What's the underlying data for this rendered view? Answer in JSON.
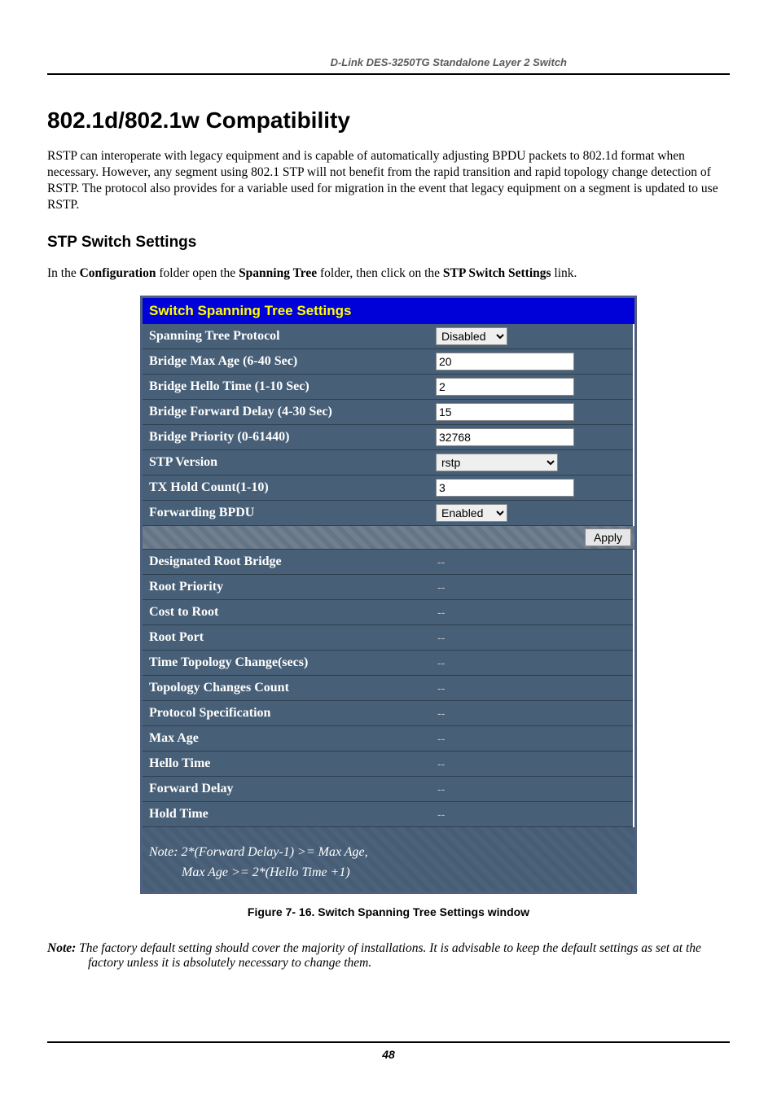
{
  "header": {
    "title": "D-Link DES-3250TG Standalone Layer 2 Switch"
  },
  "section": {
    "heading": "802.1d/802.1w Compatibility",
    "body": "RSTP can interoperate with legacy equipment and is capable of automatically adjusting BPDU packets to 802.1d format when necessary. However, any segment using 802.1 STP will not benefit from the rapid transition and rapid topology change detection of RSTP. The protocol also provides for a variable used for migration in the event that legacy equipment on a segment is updated to use RSTP."
  },
  "subsection": {
    "heading": "STP Switch Settings",
    "instruction_parts": {
      "p1": "In the ",
      "b1": "Configuration",
      "p2": " folder open the ",
      "b2": "Spanning Tree",
      "p3": " folder, then click on the ",
      "b3": "STP Switch Settings",
      "p4": " link."
    }
  },
  "panel": {
    "title": "Switch Spanning Tree Settings",
    "config_rows": [
      {
        "label": "Spanning Tree Protocol",
        "type": "select",
        "value": "Disabled",
        "width": "sm"
      },
      {
        "label": "Bridge Max Age (6-40 Sec)",
        "type": "text",
        "value": "20"
      },
      {
        "label": "Bridge Hello Time (1-10 Sec)",
        "type": "text",
        "value": "2"
      },
      {
        "label": "Bridge Forward Delay (4-30 Sec)",
        "type": "text",
        "value": "15"
      },
      {
        "label": "Bridge Priority (0-61440)",
        "type": "text",
        "value": "32768"
      },
      {
        "label": "STP Version",
        "type": "select",
        "value": "rstp",
        "width": "md"
      },
      {
        "label": "TX Hold Count(1-10)",
        "type": "text",
        "value": "3"
      },
      {
        "label": "Forwarding BPDU",
        "type": "select",
        "value": "Enabled",
        "width": "sm"
      }
    ],
    "apply_label": "Apply",
    "status_rows": [
      {
        "label": "Designated Root Bridge",
        "value": "--"
      },
      {
        "label": "Root Priority",
        "value": "--"
      },
      {
        "label": "Cost to Root",
        "value": "--"
      },
      {
        "label": "Root Port",
        "value": "--"
      },
      {
        "label": "Time Topology Change(secs)",
        "value": "--"
      },
      {
        "label": "Topology Changes Count",
        "value": "--"
      },
      {
        "label": "Protocol Specification",
        "value": "--"
      },
      {
        "label": "Max Age",
        "value": "--"
      },
      {
        "label": "Hello Time",
        "value": "--"
      },
      {
        "label": "Forward Delay",
        "value": "--"
      },
      {
        "label": "Hold Time",
        "value": "--"
      }
    ],
    "note_line1": "Note: 2*(Forward Delay-1) >= Max Age,",
    "note_line2": "Max Age >= 2*(Hello Time +1)"
  },
  "figure_caption": "Figure 7- 16.  Switch Spanning Tree Settings window",
  "footer_note": {
    "label": "Note: ",
    "text": "The factory default setting should cover the majority of installations. It is advisable to keep the default settings as set at the factory unless it is absolutely necessary to change them."
  },
  "page_number": "48"
}
